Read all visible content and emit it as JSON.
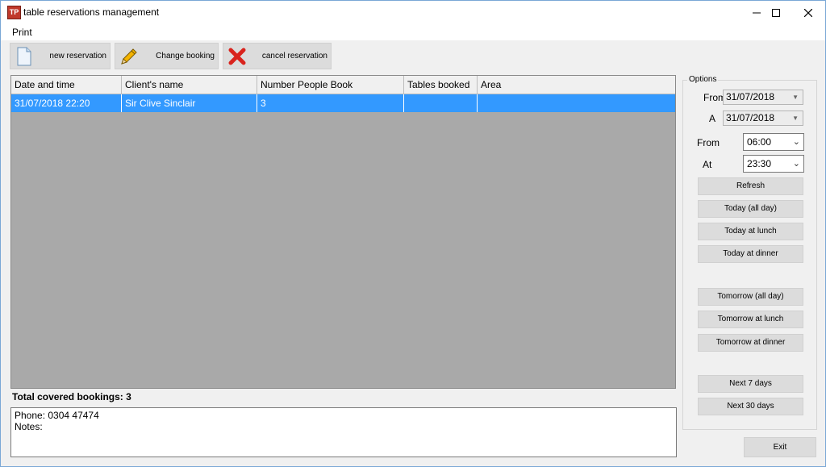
{
  "window": {
    "title": "table reservations management"
  },
  "menu": {
    "print": "Print"
  },
  "toolbar": {
    "new_reservation": "new reservation",
    "change_booking": "Change booking",
    "cancel_reservation": "cancel reservation"
  },
  "grid": {
    "columns": [
      "Date and time",
      "Client's name",
      "Number People Book",
      "Tables booked",
      "Area"
    ],
    "rows": [
      {
        "date_time": "31/07/2018 22:20",
        "client": "Sir Clive Sinclair",
        "people": "3",
        "tables": "",
        "area": ""
      }
    ],
    "selected_row_color": "#3399ff"
  },
  "summary": {
    "total_label": "Total covered bookings: 3"
  },
  "notes": {
    "phone": "Phone: 0304 47474",
    "notes": "Notes:"
  },
  "options": {
    "title": "Options",
    "date_from_label": "From",
    "date_from": "31/07/2018",
    "date_to_label": "A",
    "date_to": "31/07/2018",
    "time_from_label": "From",
    "time_from": "06:00",
    "time_to_label": "At",
    "time_to": "23:30",
    "buttons": {
      "refresh": "Refresh",
      "today_all": "Today (all day)",
      "today_lunch": "Today at lunch",
      "today_dinner": "Today at dinner",
      "tomorrow_all": "Tomorrow (all day)",
      "tomorrow_lunch": "Tomorrow at lunch",
      "tomorrow_dinner": "Tomorrow at dinner",
      "next7": "Next 7 days",
      "next30": "Next 30 days"
    }
  },
  "exit": "Exit",
  "icons": {
    "app": "restaurant-app-icon",
    "new": "document-icon",
    "change": "pencil-icon",
    "cancel": "red-x-icon"
  }
}
